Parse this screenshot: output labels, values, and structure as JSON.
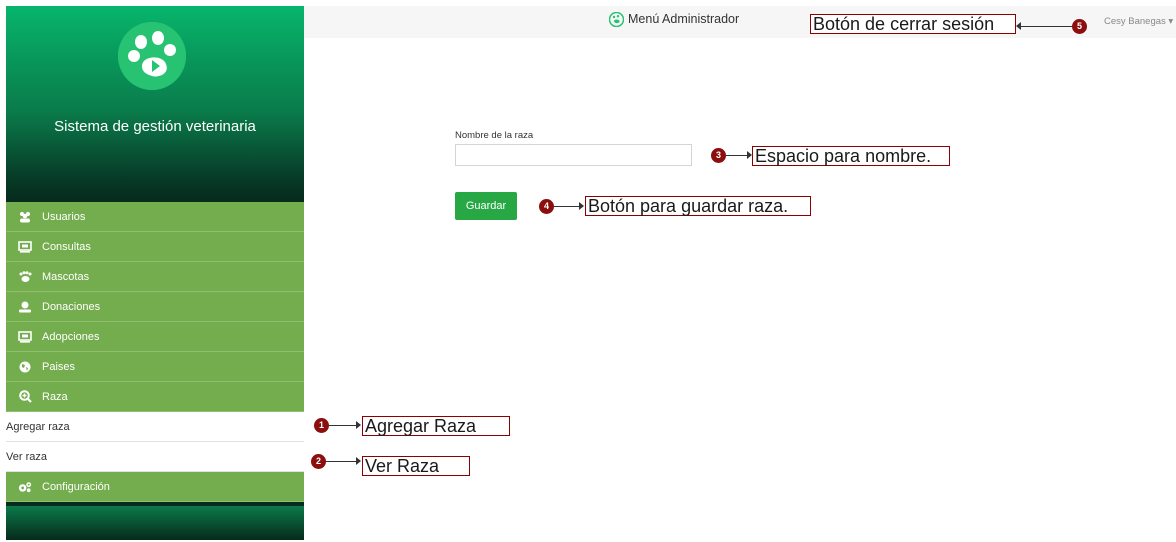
{
  "sidebar": {
    "brand": "Sistema de gestión veterinaria",
    "menu": [
      {
        "label": "Usuarios",
        "icon": "users-icon"
      },
      {
        "label": "Consultas",
        "icon": "monitor-icon"
      },
      {
        "label": "Mascotas",
        "icon": "paw-icon"
      },
      {
        "label": "Donaciones",
        "icon": "donation-icon"
      },
      {
        "label": "Adopciones",
        "icon": "monitor-icon"
      },
      {
        "label": "Paises",
        "icon": "globe-icon"
      },
      {
        "label": "Raza",
        "icon": "search-plus-icon"
      }
    ],
    "submenu": [
      {
        "label": "Agregar raza"
      },
      {
        "label": "Ver raza"
      }
    ],
    "config": {
      "label": "Configuración",
      "icon": "cogs-icon"
    }
  },
  "topbar": {
    "title": "Menú Administrador",
    "user": "Cesy Banegas ▾"
  },
  "form": {
    "label": "Nombre de la raza",
    "input_value": "",
    "save_label": "Guardar"
  },
  "annotations": [
    {
      "num": "1",
      "text": "Agregar Raza"
    },
    {
      "num": "2",
      "text": "Ver Raza"
    },
    {
      "num": "3",
      "text": "Espacio para nombre."
    },
    {
      "num": "4",
      "text": "Botón para guardar raza."
    },
    {
      "num": "5",
      "text": "Botón de cerrar sesión"
    }
  ],
  "colors": {
    "menu_green": "#74ad4d",
    "accent_green": "#28a745",
    "annotation_red": "#8b0f0f"
  }
}
